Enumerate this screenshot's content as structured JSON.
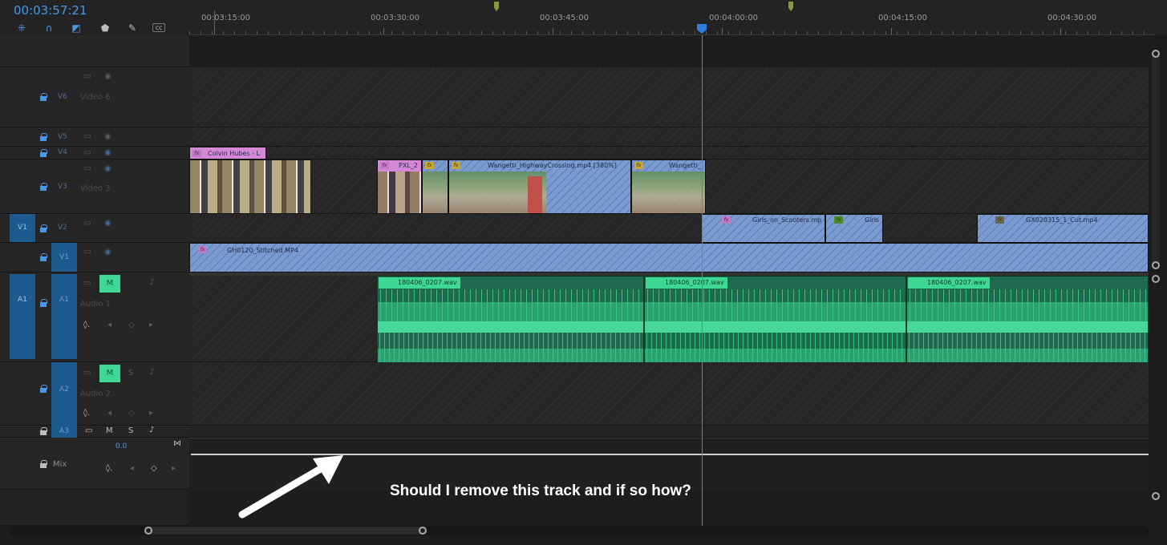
{
  "timecode": "00:03:57:21",
  "ruler": {
    "labels": [
      "00:03:15:00",
      "00:03:30:00",
      "00:03:45:00",
      "00:04:00:00",
      "00:04:15:00",
      "00:04:30:00"
    ]
  },
  "tracks": {
    "v6": {
      "name": "V6",
      "label": "Video 6"
    },
    "v5": {
      "name": "V5"
    },
    "v4": {
      "name": "V4"
    },
    "v3": {
      "name": "V3",
      "label": "Video 3"
    },
    "v2": {
      "name": "V2",
      "source": "V1"
    },
    "v1": {
      "name": "V1"
    },
    "a1": {
      "name": "A1",
      "source": "A1",
      "label": "Audio 1",
      "mute": "M"
    },
    "a2": {
      "name": "A2",
      "label": "Audio 2",
      "mute": "M",
      "solo": "S"
    },
    "a3": {
      "name": "A3",
      "mute": "M",
      "solo": "S"
    },
    "mix": {
      "label": "Mix",
      "value": "0.0"
    }
  },
  "clips": {
    "v4_colvin": "Colvin Hubes - L",
    "v3_pxl": "PXL_2",
    "v3_wangetti": "Wangetti_HighwayCrossing.mp4 [380%]",
    "v3_wangetti2": "Wangetti_",
    "v2_girls": "Girls_on_Scooters.mp",
    "v2_girls2": "Girls",
    "v2_gx": "GX020315_1_Cut.mp4",
    "v1_gh": "GH0120_Stitched.MP4",
    "a1_wav1": "180406_0207.wav",
    "a1_wav2": "180406_0207.wav",
    "a1_wav3": "180406_0207.wav"
  },
  "annotation": "Should I remove this track and if so how?",
  "colors": {
    "accent": "#4a97e8",
    "playhead": "#3a8cf0",
    "audio": "#3fd892",
    "video": "#7b9ad0"
  }
}
